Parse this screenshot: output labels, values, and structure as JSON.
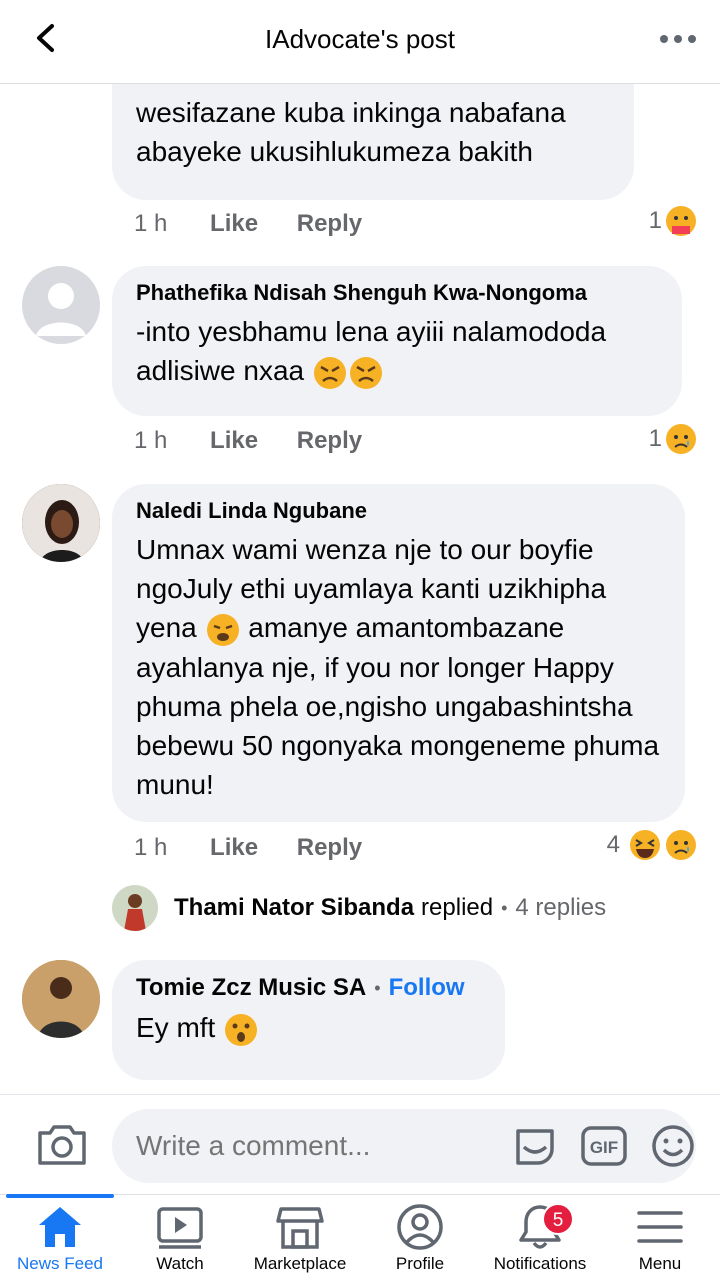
{
  "header": {
    "title": "IAdvocate's post"
  },
  "comments": [
    {
      "text": "sihlale la edinwa khona muntu wesifazane kuba inkinga nabafana abayeke ukusihlukumeza bakith",
      "time": "1 h",
      "like": "Like",
      "reply": "Reply",
      "reaction_count": "1"
    },
    {
      "author": "Phathefika Ndisah Shenguh Kwa-Nongoma",
      "text": "-into yesbhamu lena ayiii nalamododa adlisiwe nxaa",
      "time": "1 h",
      "like": "Like",
      "reply": "Reply",
      "reaction_count": "1"
    },
    {
      "author": "Naledi Linda Ngubane",
      "text_a": "Umnax wami wenza nje to our boyfie ngoJuly ethi uyamlaya kanti uzikhipha yena",
      "text_b": "amanye amantombazane ayahlanya nje, if you nor longer Happy phuma phela oe,ngisho ungabashintsha bebewu 50 ngonyaka mongeneme phuma munu!",
      "time": "1 h",
      "like": "Like",
      "reply": "Reply",
      "reaction_count": "4",
      "replies": {
        "author": "Thami Nator Sibanda",
        "action": "replied",
        "count": "4 replies"
      }
    },
    {
      "author": "Tomie Zcz Music SA",
      "follow": "Follow",
      "text": "Ey mft"
    }
  ],
  "composer": {
    "placeholder": "Write a comment..."
  },
  "nav": {
    "items": [
      {
        "label": "News Feed",
        "icon": "home-icon",
        "active": true
      },
      {
        "label": "Watch",
        "icon": "watch-icon"
      },
      {
        "label": "Marketplace",
        "icon": "marketplace-icon"
      },
      {
        "label": "Profile",
        "icon": "profile-icon"
      },
      {
        "label": "Notifications",
        "icon": "bell-icon",
        "badge": "5"
      },
      {
        "label": "Menu",
        "icon": "menu-icon"
      }
    ]
  },
  "colors": {
    "accent": "#1877f2",
    "bubble": "#f0f2f5",
    "muted": "#65676b",
    "badge": "#e41e3f"
  }
}
